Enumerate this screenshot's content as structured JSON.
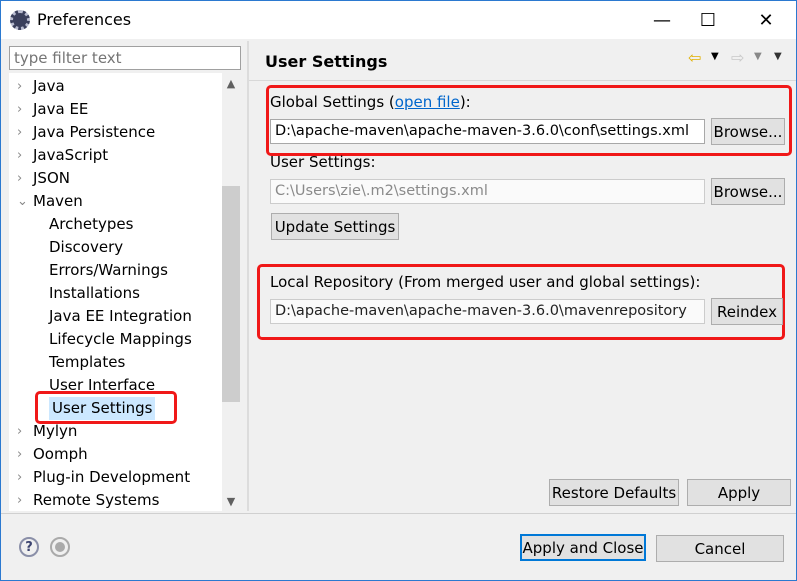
{
  "window": {
    "title": "Preferences",
    "minimize": "—",
    "maximize": "☐",
    "close": "✕"
  },
  "filter": {
    "placeholder": "type filter text"
  },
  "tree": [
    {
      "label": "Java",
      "level": 0,
      "expanded": false
    },
    {
      "label": "Java EE",
      "level": 0,
      "expanded": false
    },
    {
      "label": "Java Persistence",
      "level": 0,
      "expanded": false
    },
    {
      "label": "JavaScript",
      "level": 0,
      "expanded": false
    },
    {
      "label": "JSON",
      "level": 0,
      "expanded": false
    },
    {
      "label": "Maven",
      "level": 0,
      "expanded": true
    },
    {
      "label": "Archetypes",
      "level": 1
    },
    {
      "label": "Discovery",
      "level": 1
    },
    {
      "label": "Errors/Warnings",
      "level": 1
    },
    {
      "label": "Installations",
      "level": 1
    },
    {
      "label": "Java EE Integration",
      "level": 1
    },
    {
      "label": "Lifecycle Mappings",
      "level": 1
    },
    {
      "label": "Templates",
      "level": 1
    },
    {
      "label": "User Interface",
      "level": 1
    },
    {
      "label": "User Settings",
      "level": 1,
      "selected": true
    },
    {
      "label": "Mylyn",
      "level": 0,
      "expanded": false
    },
    {
      "label": "Oomph",
      "level": 0,
      "expanded": false
    },
    {
      "label": "Plug-in Development",
      "level": 0,
      "expanded": false
    },
    {
      "label": "Remote Systems",
      "level": 0,
      "expanded": false
    }
  ],
  "page": {
    "title": "User Settings",
    "global_label": "Global Settings (",
    "open_file": "open file",
    "global_label_end": "):",
    "global_value": "D:\\apache-maven\\apache-maven-3.6.0\\conf\\settings.xml",
    "browse": "Browse...",
    "user_label": "User Settings:",
    "user_value": "C:\\Users\\zie\\.m2\\settings.xml",
    "update": "Update Settings",
    "local_label": "Local Repository (From merged user and global settings):",
    "local_value": "D:\\apache-maven\\apache-maven-3.6.0\\mavenrepository",
    "reindex": "Reindex",
    "restore": "Restore Defaults",
    "apply": "Apply"
  },
  "footer": {
    "apply_close": "Apply and Close",
    "cancel": "Cancel",
    "help": "?"
  },
  "colors": {
    "highlight": "#f01818",
    "selection": "#cce8ff",
    "accent": "#0078d7"
  }
}
